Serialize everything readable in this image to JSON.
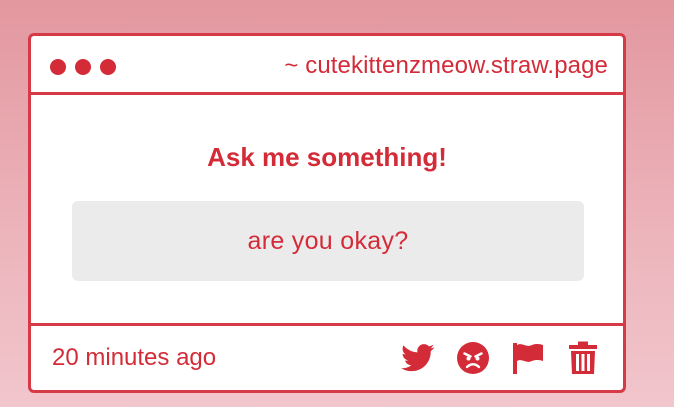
{
  "window": {
    "url": "~ cutekittenzmeow.straw.page"
  },
  "main": {
    "title": "Ask me something!",
    "question": "are you okay?"
  },
  "footer": {
    "timestamp": "20 minutes ago",
    "actions": [
      {
        "icon": "twitter-icon"
      },
      {
        "icon": "angry-face-icon"
      },
      {
        "icon": "flag-icon"
      },
      {
        "icon": "trash-icon"
      }
    ]
  },
  "colors": {
    "accent": "#d32c38",
    "border": "#d63a47",
    "question_bg": "#ecebec"
  }
}
